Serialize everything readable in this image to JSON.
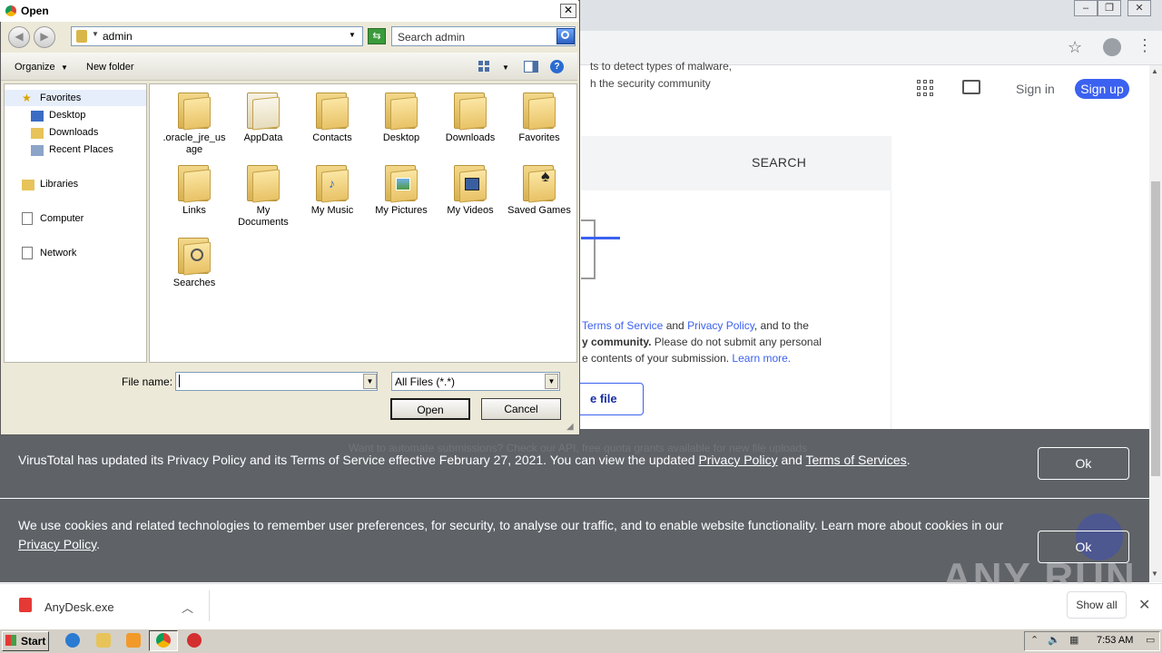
{
  "browser": {
    "window_controls": [
      "–",
      "❐",
      "✕"
    ],
    "vt_text_line1": "ts to detect types of malware,",
    "vt_text_line2": "h the security community",
    "sign_in": "Sign in",
    "sign_up": "Sign up",
    "search_tab": "SEARCH",
    "terms_line1_a": "Terms of Service",
    "terms_line1_b": " and ",
    "terms_line1_c": "Privacy Policy",
    "terms_line1_d": ", and to the",
    "terms_line2_a": "y community.",
    "terms_line2_b": " Please do not submit any personal",
    "terms_line3_a": "e contents of your submission. ",
    "terms_line3_b": "Learn more.",
    "choose_file_fragment": "e file",
    "behind_banner_text": "Want to automate submissions? Check our API, free quota grants available for new file uploads"
  },
  "banner_policy": {
    "text_a": "VirusTotal has updated its Privacy Policy and its Terms of Service effective February 27, 2021. You can view the updated ",
    "link_privacy": "Privacy Policy",
    "text_and": " and ",
    "link_terms": "Terms of Services",
    "text_end": ".",
    "ok": "Ok"
  },
  "banner_cookies": {
    "text": "We use cookies and related technologies to remember user preferences, for security, to analyse our traffic, and to enable website functionality. Learn more about cookies in our ",
    "link": "Privacy Policy",
    "text_end": ".",
    "ok": "Ok"
  },
  "watermark": "ANY RUN",
  "download_shelf": {
    "file_name": "AnyDesk.exe",
    "show_all": "Show all"
  },
  "taskbar": {
    "start": "Start",
    "time": "7:53 AM"
  },
  "dialog": {
    "title": "Open",
    "address": "admin",
    "search_placeholder": "Search admin",
    "toolbar": {
      "organize": "Organize",
      "new_folder": "New folder"
    },
    "nav": {
      "favorites": "Favorites",
      "desktop": "Desktop",
      "downloads": "Downloads",
      "recent_places": "Recent Places",
      "libraries": "Libraries",
      "computer": "Computer",
      "network": "Network"
    },
    "folders": [
      ".oracle_jre_usage",
      "AppData",
      "Contacts",
      "Desktop",
      "Downloads",
      "Favorites",
      "Links",
      "My Documents",
      "My Music",
      "My Pictures",
      "My Videos",
      "Saved Games",
      "Searches"
    ],
    "file_name_label": "File name:",
    "file_name_value": "",
    "file_type": "All Files (*.*)",
    "open_button": "Open",
    "cancel_button": "Cancel"
  }
}
